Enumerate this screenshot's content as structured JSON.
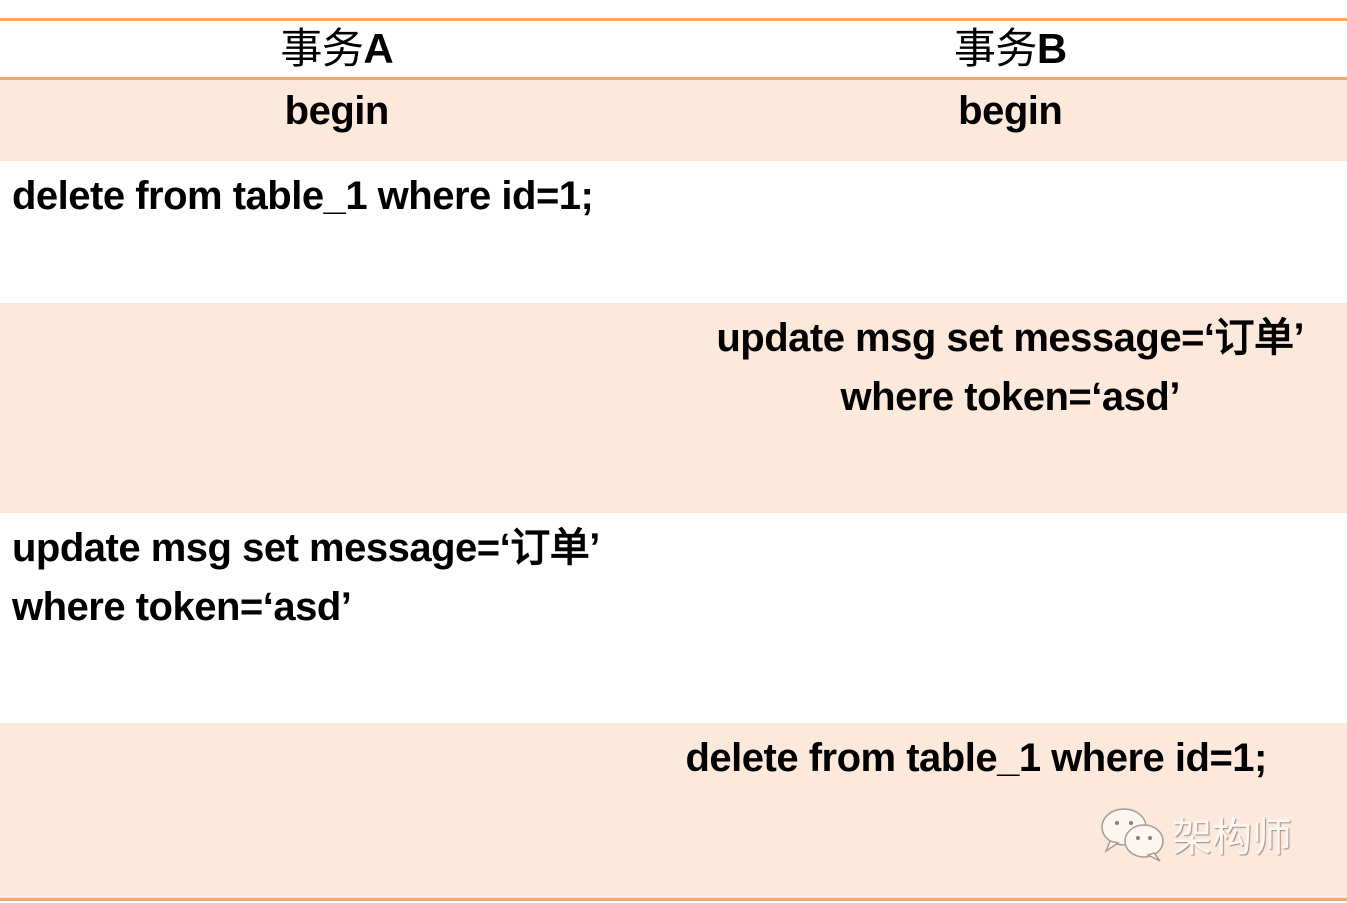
{
  "table": {
    "headers": [
      {
        "cjk": "事务",
        "suffix": "A"
      },
      {
        "cjk": "事务",
        "suffix": "B"
      }
    ],
    "rows": [
      {
        "a": "begin",
        "b": "begin"
      },
      {
        "a": "delete from table_1 where id=1;",
        "b": ""
      },
      {
        "a": "",
        "b": "update msg set message=‘订单’ where token=‘asd’"
      },
      {
        "a": "update msg set message=‘订单’ where token=‘asd’",
        "b": ""
      },
      {
        "a": "",
        "b": "delete from table_1 where id=1;"
      }
    ]
  },
  "watermark": {
    "icon": "wechat-icon",
    "text": "架构师"
  },
  "colors": {
    "border": "#f0a86e",
    "shade": "#fde9db"
  }
}
